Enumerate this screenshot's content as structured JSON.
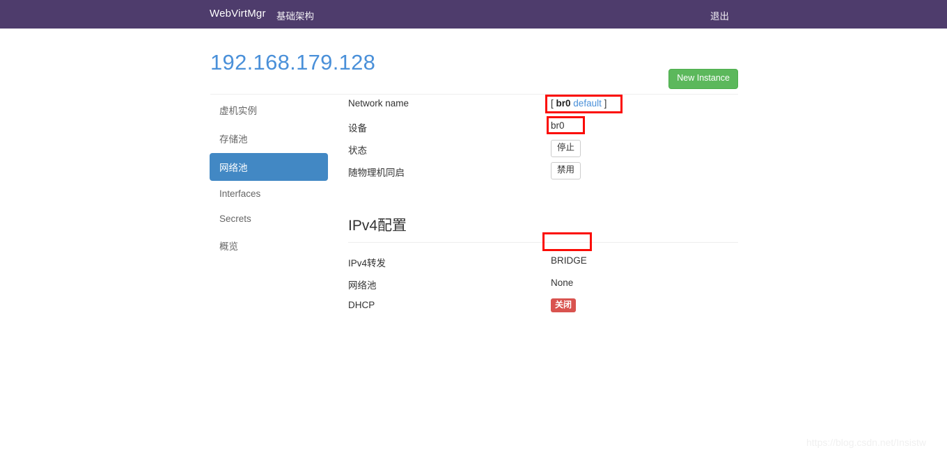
{
  "navbar": {
    "brand": "WebVirtMgr",
    "infrastructure_label": "基础架构",
    "logout_label": "退出",
    "background_color": "#4e3c6c"
  },
  "header": {
    "title": "192.168.179.128",
    "title_color": "#4a90d9",
    "new_instance_label": "New Instance",
    "new_instance_color": "#5cb85c"
  },
  "sidebar": {
    "items": [
      {
        "label": "虚机实例",
        "active": false
      },
      {
        "label": "存储池",
        "active": false
      },
      {
        "label": "网络池",
        "active": true
      },
      {
        "label": "Interfaces",
        "active": false
      },
      {
        "label": "Secrets",
        "active": false
      },
      {
        "label": "概览",
        "active": false
      }
    ],
    "active_color": "#4288c4"
  },
  "network_detail": {
    "rows": [
      {
        "label": "Network name",
        "value_prefix": "[ ",
        "value_strong": "br0",
        "value_link": "default",
        "value_suffix": " ]"
      },
      {
        "label": "设备",
        "value": "br0"
      },
      {
        "label": "状态",
        "button": "停止"
      },
      {
        "label": "随物理机同启",
        "button": "禁用"
      }
    ]
  },
  "ipv4_section": {
    "heading": "IPv4配置",
    "rows": [
      {
        "label": "IPv4转发",
        "value": "BRIDGE"
      },
      {
        "label": "网络池",
        "value": "None"
      },
      {
        "label": "DHCP",
        "badge": "关闭",
        "badge_color": "#d9534f"
      }
    ]
  },
  "annotations": {
    "color": "#fb0b05",
    "boxes": [
      {
        "name": "network-name-highlight"
      },
      {
        "name": "device-highlight"
      },
      {
        "name": "ipv4-forward-highlight"
      }
    ]
  },
  "watermark": {
    "text": "https://blog.csdn.net/Insistw"
  }
}
